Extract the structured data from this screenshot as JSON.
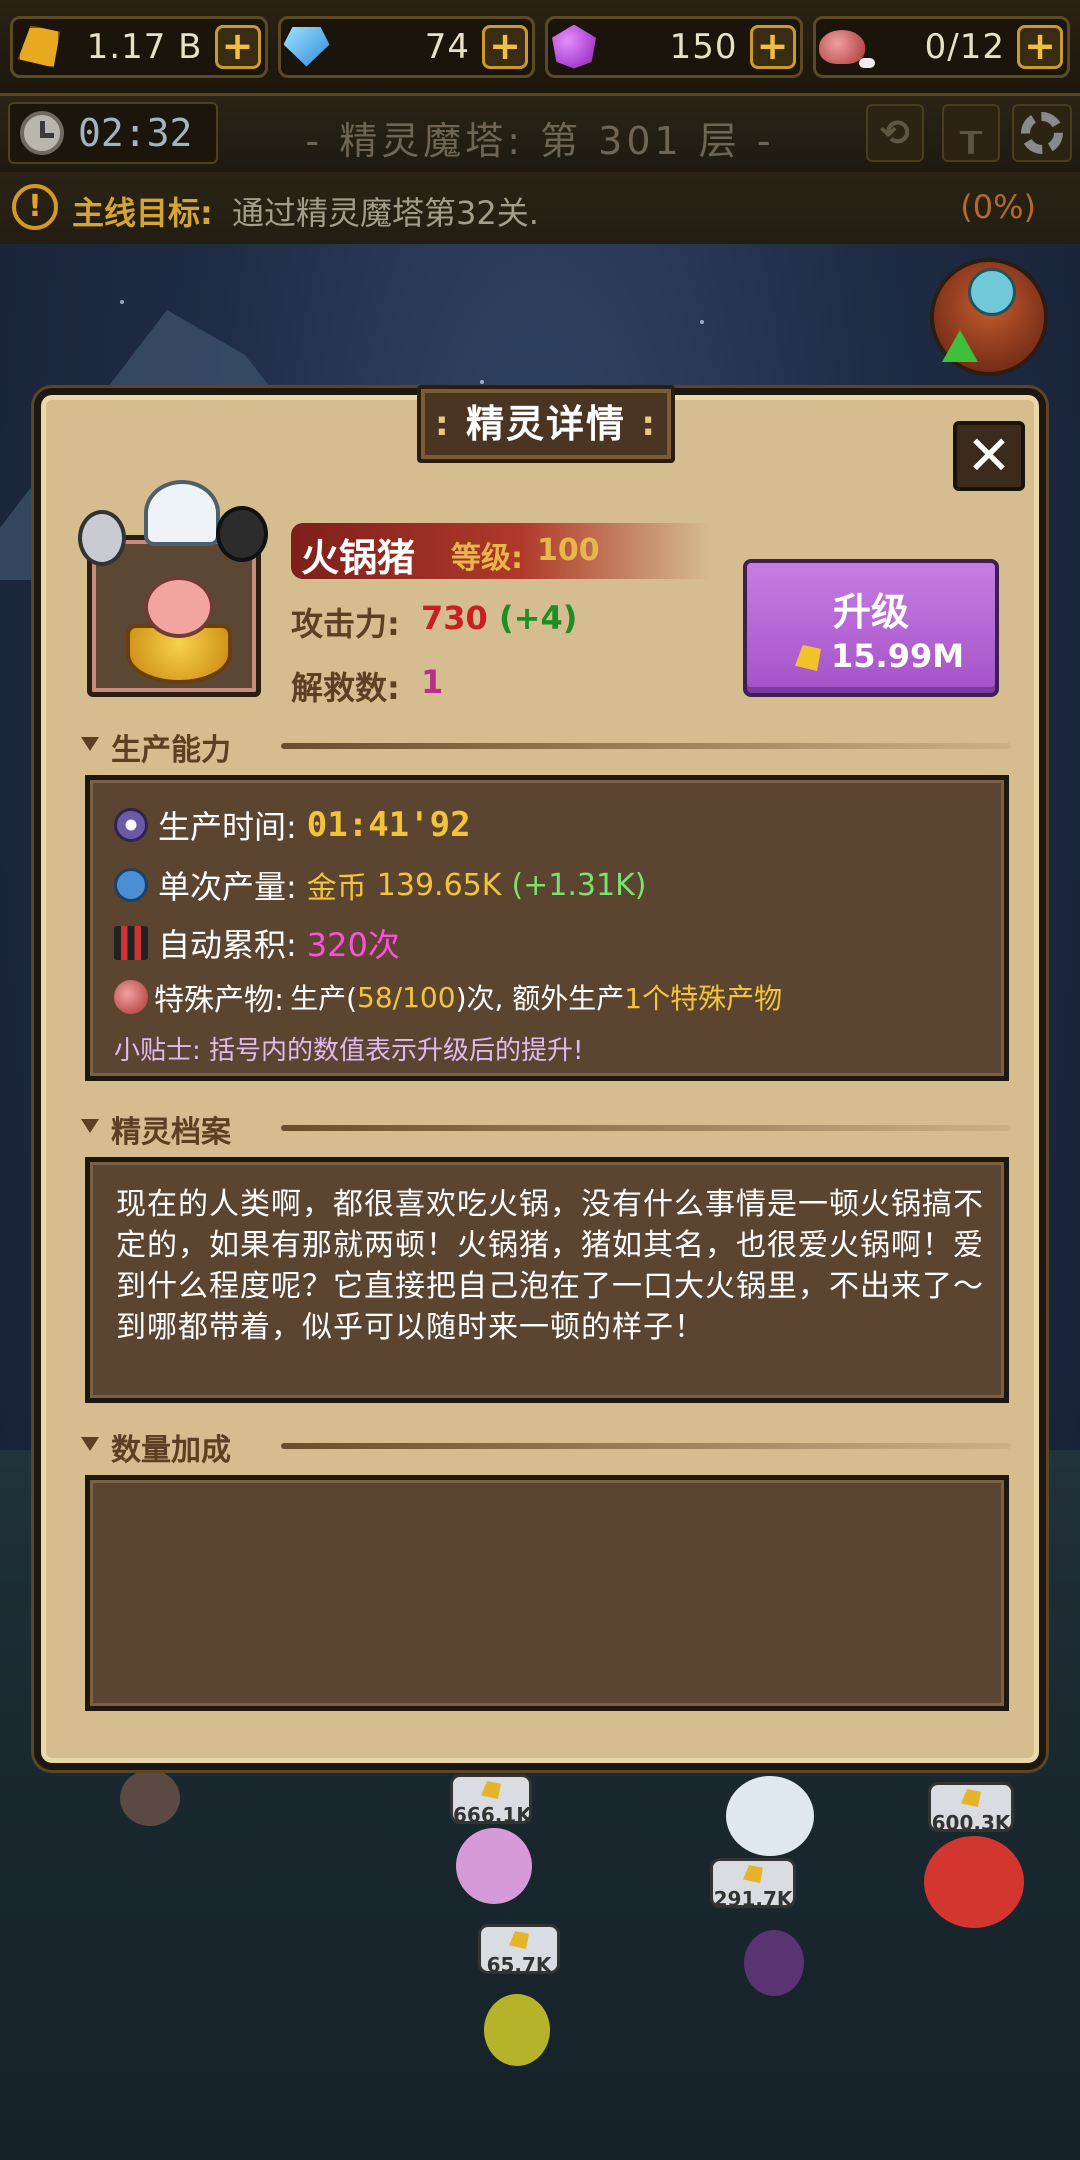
{
  "resources": [
    {
      "name": "gold",
      "value": "1.17 B",
      "icon": "gold-gem-icon"
    },
    {
      "name": "diamond",
      "value": "74",
      "icon": "blue-diamond-icon"
    },
    {
      "name": "purple_gem",
      "value": "150",
      "icon": "purple-gem-icon"
    },
    {
      "name": "meat",
      "value": "0/12",
      "icon": "meat-icon"
    }
  ],
  "plus_label": "+",
  "header": {
    "timer": "02:32",
    "floor_title": "- 精灵魔塔: 第 301 层 -"
  },
  "quest": {
    "label": "主线目标:",
    "text": "通过精灵魔塔第32关.",
    "progress": "(0%)",
    "warn_glyph": "!"
  },
  "panel": {
    "title": "精灵详情",
    "close_label": "✕",
    "sprite": {
      "name": "火锅猪",
      "level_label": "等级:",
      "level": "100",
      "attack_label": "攻击力:",
      "attack": "730",
      "attack_increase": "(+4)",
      "rescue_label": "解救数:",
      "rescue": "1"
    },
    "upgrade": {
      "label": "升级",
      "price": "15.99M"
    },
    "sections": {
      "production": {
        "title": "生产能力",
        "time_label": "生产时间:",
        "time_value": "01:41'92",
        "yield_label": "单次产量:",
        "yield_currency": "金币",
        "yield_value": "139.65K",
        "yield_increase": "(+1.31K)",
        "auto_label": "自动累积:",
        "auto_value": "320次",
        "special_label": "特殊产物:",
        "special_prefix": "生产(",
        "special_progress": "58/100",
        "special_mid": ")次, 额外生产",
        "special_extra": "1个特殊产物",
        "tip": "小贴士: 括号内的数值表示升级后的提升!"
      },
      "profile": {
        "title": "精灵档案",
        "text": "现在的人类啊，都很喜欢吃火锅，没有什么事情是一顿火锅搞不定的，如果有那就两顿！火锅猪，猪如其名，也很爱火锅啊！爱到什么程度呢？它直接把自己泡在了一口大火锅里，不出来了～到哪都带着，似乎可以随时来一顿的样子！"
      },
      "bonus": {
        "title": "数量加成"
      }
    }
  },
  "ground_bubbles": [
    "666.1K",
    "600.3K",
    "291.7K",
    "65.7K"
  ],
  "colors": {
    "panel_bg": "#d5bd8f",
    "box_bg": "#5c4530",
    "upgrade_button": "#b861d6",
    "gold_text": "#f2c43a",
    "green_text": "#7be36b",
    "pink_text": "#ff50dc",
    "attack_red": "#c8201f"
  }
}
